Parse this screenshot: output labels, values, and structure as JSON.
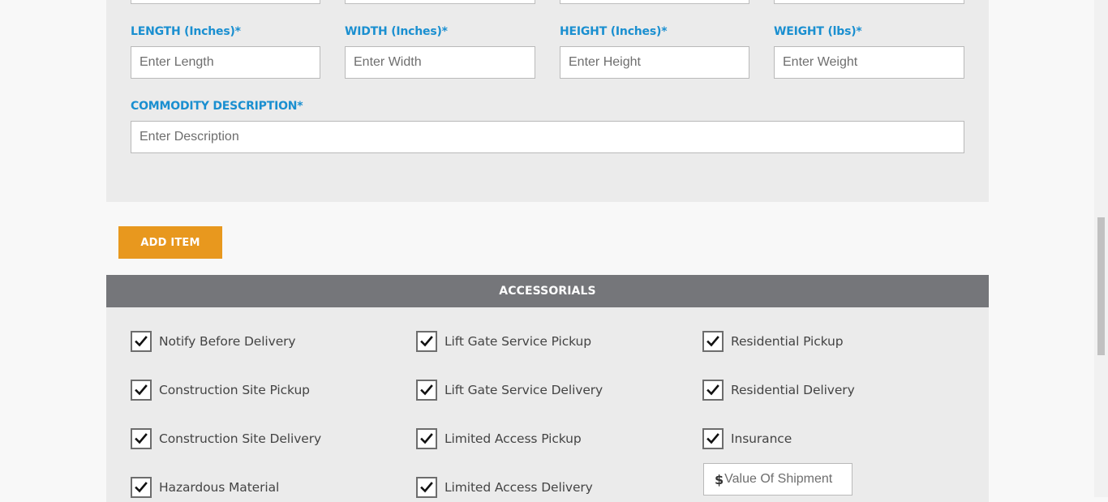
{
  "dimensions": {
    "length_label": "LENGTH (Inches)*",
    "length_placeholder": "Enter Length",
    "width_label": "WIDTH (Inches)*",
    "width_placeholder": "Enter Width",
    "height_label": "HEIGHT (Inches)*",
    "height_placeholder": "Enter Height",
    "weight_label": "WEIGHT (lbs)*",
    "weight_placeholder": "Enter Weight",
    "commodity_label": "COMMODITY DESCRIPTION*",
    "commodity_placeholder": "Enter Description"
  },
  "add_item_label": "ADD ITEM",
  "accessorials": {
    "title": "ACCESSORIALS",
    "options": [
      {
        "label": "Notify Before Delivery",
        "checked": true
      },
      {
        "label": "Lift Gate Service Pickup",
        "checked": true
      },
      {
        "label": "Residential Pickup",
        "checked": true
      },
      {
        "label": "Construction Site Pickup",
        "checked": true
      },
      {
        "label": "Lift Gate Service Delivery",
        "checked": true
      },
      {
        "label": "Residential Delivery",
        "checked": true
      },
      {
        "label": "Construction Site Delivery",
        "checked": true
      },
      {
        "label": "Limited Access Pickup",
        "checked": true
      },
      {
        "label": "Insurance",
        "checked": true
      },
      {
        "label": "Hazardous Material",
        "checked": true
      },
      {
        "label": "Limited Access Delivery",
        "checked": true
      }
    ],
    "value_prefix": "$",
    "value_placeholder": "Value Of Shipment"
  },
  "colors": {
    "label_blue": "#1a8fd0",
    "button_orange": "#e8981e",
    "header_gray": "#75767a",
    "panel_gray": "#ebebeb"
  }
}
